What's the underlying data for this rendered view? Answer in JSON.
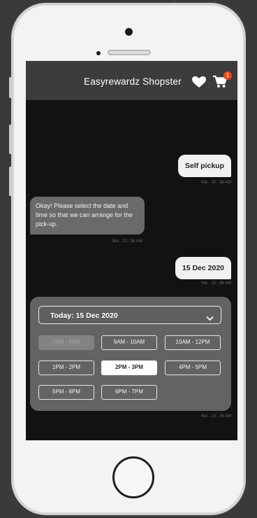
{
  "app": {
    "title": "Easyrewardz Shopster",
    "cart_count": "1"
  },
  "chat": {
    "messages": [
      {
        "sender": "You",
        "text": "Self pickup",
        "time": "You . 10 : 36 AM"
      },
      {
        "sender": "Bot",
        "text": "Okay! Please select the date and time so that we can arrange for the pick-up.",
        "time": "Bot . 10 : 36 AM"
      },
      {
        "sender": "You",
        "text": "15 Dec 2020",
        "time": "You . 10 : 36 AM"
      }
    ],
    "picker": {
      "date_label": "Today: 15 Dec 2020",
      "slots": [
        {
          "label": "7AM - 8AM",
          "state": "disabled"
        },
        {
          "label": "9AM - 10AM",
          "state": "available"
        },
        {
          "label": "10AM - 12PM",
          "state": "available"
        },
        {
          "label": "1PM - 2PM",
          "state": "available"
        },
        {
          "label": "2PM - 3PM",
          "state": "selected"
        },
        {
          "label": "4PM - 5PM",
          "state": "available"
        },
        {
          "label": "5PM - 6PM",
          "state": "available"
        },
        {
          "label": "6PM - 7PM",
          "state": "available"
        }
      ],
      "time": "Bot . 10 : 36 AM"
    }
  },
  "icons": {
    "heart": "heart-icon",
    "cart": "cart-icon",
    "chevron": "chevron-down-icon"
  },
  "colors": {
    "appbar": "#3c3c3c",
    "screen_bg": "#121212",
    "bot_bubble": "#6a6a6a",
    "user_bubble": "#f1f1f1",
    "picker_bg": "#636363",
    "badge": "#e64a19"
  }
}
